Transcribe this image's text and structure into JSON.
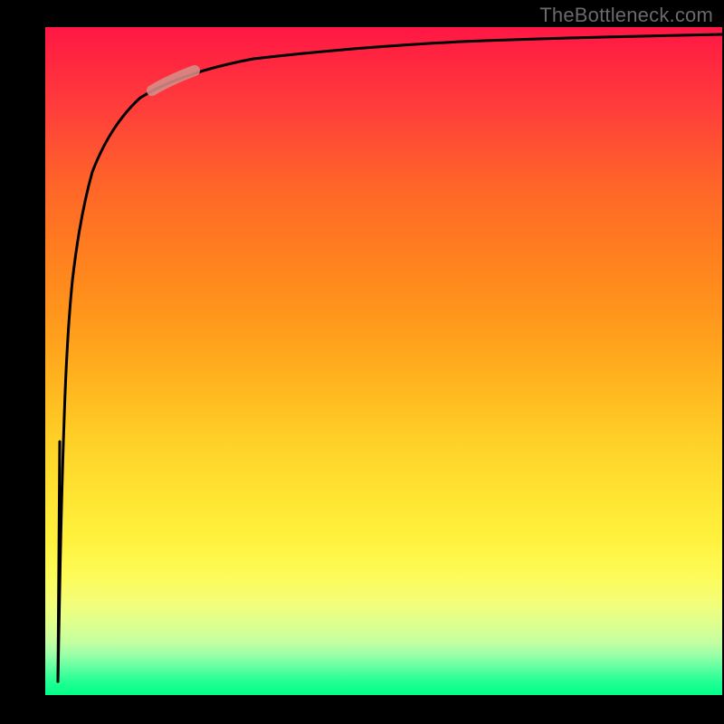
{
  "watermark": "TheBottleneck.com",
  "chart_data": {
    "type": "line",
    "title": "",
    "xlabel": "",
    "ylabel": "",
    "xlim": [
      0,
      100
    ],
    "ylim": [
      0,
      100
    ],
    "grid": false,
    "gradient_background": {
      "top_color": "#ff1744",
      "mid_colors": [
        "#ff8e1c",
        "#fff23e"
      ],
      "bottom_color": "#00ff88",
      "meaning": "red=high bottleneck, green=no bottleneck"
    },
    "series": [
      {
        "name": "bottleneck-curve",
        "points": [
          {
            "x": 2.0,
            "y": 2
          },
          {
            "x": 2.3,
            "y": 14
          },
          {
            "x": 2.6,
            "y": 28
          },
          {
            "x": 3.0,
            "y": 42
          },
          {
            "x": 3.6,
            "y": 55
          },
          {
            "x": 4.5,
            "y": 66
          },
          {
            "x": 6.0,
            "y": 75
          },
          {
            "x": 8.5,
            "y": 82
          },
          {
            "x": 12.0,
            "y": 87
          },
          {
            "x": 18.0,
            "y": 90.5
          },
          {
            "x": 28.0,
            "y": 93
          },
          {
            "x": 42.0,
            "y": 94.8
          },
          {
            "x": 60.0,
            "y": 96
          },
          {
            "x": 80.0,
            "y": 96.8
          },
          {
            "x": 100.0,
            "y": 97.2
          }
        ]
      },
      {
        "name": "highlight-segment",
        "color": "#d38b85",
        "points": [
          {
            "x": 12.0,
            "y": 86.5
          },
          {
            "x": 19.0,
            "y": 90.5
          }
        ]
      },
      {
        "name": "initial-drop",
        "points": [
          {
            "x": 2.2,
            "y": 38
          },
          {
            "x": 2.0,
            "y": 2
          }
        ]
      }
    ]
  }
}
